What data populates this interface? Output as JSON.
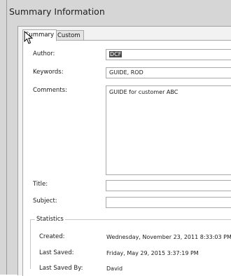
{
  "window": {
    "title": "Summary Information"
  },
  "tabs": [
    {
      "label": "Summary",
      "active": true
    },
    {
      "label": "Custom",
      "active": false
    }
  ],
  "fields": {
    "author": {
      "label": "Author:",
      "value": "DCF"
    },
    "keywords": {
      "label": "Keywords:",
      "value": "GUIDE, ROD"
    },
    "comments": {
      "label": "Comments:",
      "value": "GUIDE for customer ABC"
    },
    "title": {
      "label": "Title:",
      "value": ""
    },
    "subject": {
      "label": "Subject:",
      "value": ""
    }
  },
  "statistics": {
    "legend": "Statistics",
    "created": {
      "label": "Created:",
      "value": "Wednesday, November 23, 2011 8:33:03 PM"
    },
    "last_saved": {
      "label": "Last Saved:",
      "value": "Friday, May 29, 2015 3:37:19 PM"
    },
    "last_saved_by": {
      "label": "Last Saved By:",
      "value": "David"
    }
  },
  "icons": {
    "cursor": "mouse-pointer-icon"
  }
}
